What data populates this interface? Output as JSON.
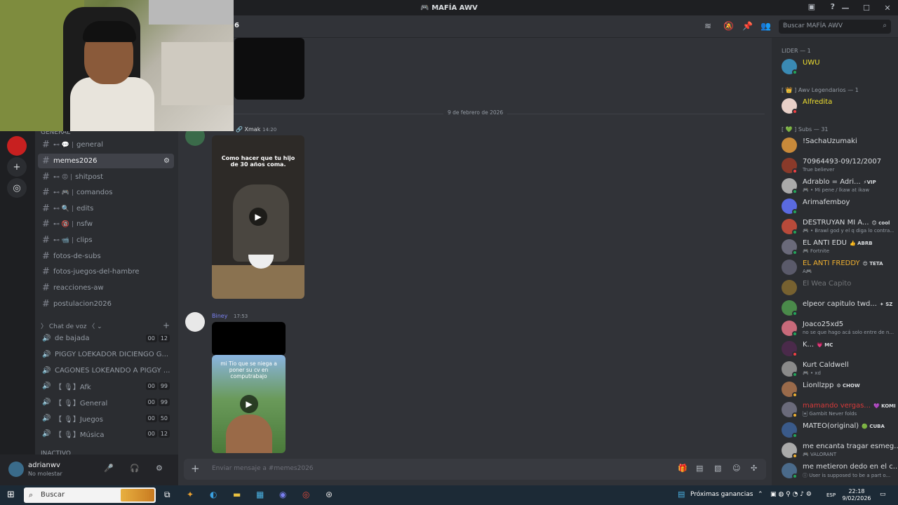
{
  "window": {
    "title": "MAFÍA AWV",
    "header_fragment": "6"
  },
  "search": {
    "placeholder": "Buscar MAFÍA AWV"
  },
  "sidebar": {
    "category_general": "GENERAL",
    "text_channels": [
      {
        "name": "general",
        "prefix": "⊷ 💬 |"
      },
      {
        "name": "memes2026",
        "prefix": "",
        "active": true
      },
      {
        "name": "shitpost",
        "prefix": "⊷ 😡 |"
      },
      {
        "name": "comandos",
        "prefix": "⊷ 🎮 |"
      },
      {
        "name": "edits",
        "prefix": "⊷ 🔍 |"
      },
      {
        "name": "nsfw",
        "prefix": "⊷ 🔞 |"
      },
      {
        "name": "clips",
        "prefix": "⊷ 📹 |"
      },
      {
        "name": "fotos-de-subs",
        "prefix": ""
      },
      {
        "name": "fotos-juegos-del-hambre",
        "prefix": ""
      },
      {
        "name": "reacciones-aw",
        "prefix": ""
      },
      {
        "name": "postulacion2026",
        "prefix": ""
      }
    ],
    "category_voice": "Chat de voz",
    "voice_channels": [
      {
        "name": "de bajada",
        "a": "00",
        "b": "12"
      },
      {
        "name": "PIGGY LOEKADOR DICIENGO G...",
        "a": "",
        "b": ""
      },
      {
        "name": "CAGONES LOKEANDO A PIGGY ...",
        "a": "",
        "b": ""
      },
      {
        "name": "【 🎙】Afk",
        "a": "00",
        "b": "99"
      },
      {
        "name": "【 🎙】General",
        "a": "00",
        "b": "99"
      },
      {
        "name": "【 🎙】Juegos",
        "a": "00",
        "b": "50"
      },
      {
        "name": "【 🎙】Música",
        "a": "00",
        "b": "12"
      }
    ],
    "category_inactive": "INACTIVO"
  },
  "user": {
    "name": "adrianwv",
    "status": "No molestar"
  },
  "chat": {
    "date_divider": "9 de febrero de 2026",
    "msg1": {
      "author": "Xmak",
      "time": "14:20",
      "caption": "Como hacer que tu hijo de 30 años coma."
    },
    "msg2": {
      "author": "Biney",
      "time": "17:53",
      "caption": "mi Tío que se niega a poner su cv en computrabajo"
    },
    "composer_placeholder": "Enviar mensaje a #memes2026"
  },
  "members": {
    "cat_lider": "LIDER — 1",
    "cat_legend": "[ 👑 ] Awv Legendarios — 1",
    "cat_subs": "[ 💚 ] Subs — 31",
    "list": [
      {
        "name": "UWU",
        "status": "",
        "tag": "",
        "color": "#f0e030"
      },
      {
        "name": "Alfredita",
        "status": "",
        "tag": "",
        "color": "#f0e030"
      },
      {
        "name": "!SachaUzumaki",
        "status": "",
        "tag": "",
        "color": "#dbdee1"
      },
      {
        "name": "70964493-09/12/2007",
        "status": "True believer",
        "tag": "",
        "color": "#dbdee1"
      },
      {
        "name": "Adrablo = Adri...",
        "status": "🎮 • Mi pene / lkaw at ikaw",
        "tag": "⚡VIP",
        "color": "#dbdee1"
      },
      {
        "name": "Arimafemboy",
        "status": "",
        "tag": "",
        "color": "#dbdee1"
      },
      {
        "name": "DESTRUYAN MI A...",
        "status": "🎮 • Brawl god y el q diga lo contra...",
        "tag": "😊 cool",
        "color": "#dbdee1"
      },
      {
        "name": "EL ANTI EDU",
        "status": "🎮 Fortnite",
        "tag": "👍 ABRB",
        "color": "#dbdee1"
      },
      {
        "name": "EL ANTI FREDDY",
        "status": "A🎮",
        "tag": "😍 TETA",
        "color": "#f0b030"
      },
      {
        "name": "El Wea Capito",
        "status": "",
        "tag": "",
        "color": "#5a5c62"
      },
      {
        "name": "elpeor capitulo twd...",
        "status": "",
        "tag": "✦ SZ",
        "color": "#dbdee1"
      },
      {
        "name": "Joaco25xd5",
        "status": "no se que hago acá solo entre de n...",
        "tag": "",
        "color": "#dbdee1"
      },
      {
        "name": "K...",
        "status": "",
        "tag": "💗 MC",
        "color": "#dbdee1"
      },
      {
        "name": "Kurt Caldwell",
        "status": "🎮 • xd",
        "tag": "",
        "color": "#dbdee1"
      },
      {
        "name": "Lionllzpp",
        "status": "",
        "tag": "⚙ CHOW",
        "color": "#dbdee1"
      },
      {
        "name": "mamando vergas...",
        "status": "🃏 Gambit Never folds",
        "tag": "💜 KOMI",
        "color": "#d83a3a"
      },
      {
        "name": "MATEO(original)",
        "status": "",
        "tag": "🟢 CUBA",
        "color": "#dbdee1"
      },
      {
        "name": "me encanta tragar esmeg...",
        "status": "🎮 VALORANT",
        "tag": "",
        "color": "#dbdee1"
      },
      {
        "name": "me metieron dedo en el c...",
        "status": "ⓘ User is supposed to be a part o...",
        "tag": "",
        "color": "#dbdee1"
      }
    ]
  },
  "taskbar": {
    "search_label": "Buscar",
    "widget": "Próximas ganancias",
    "lang": "ESP",
    "time": "22:18",
    "date": "9/02/2026"
  },
  "colors": {
    "accent": "#5865f2",
    "online": "#23a55a",
    "dnd": "#f23f43"
  }
}
